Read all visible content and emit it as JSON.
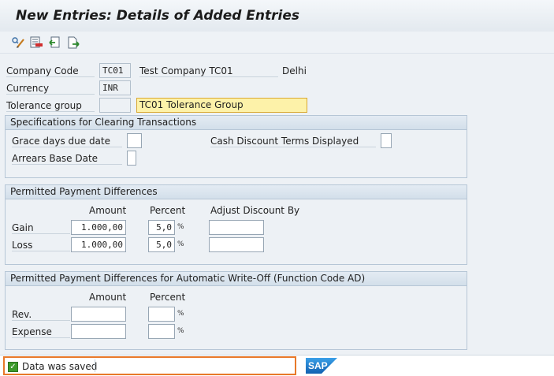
{
  "title": "New Entries: Details of Added Entries",
  "toolbar": {
    "buttons": [
      {
        "icon": "display-change-icon"
      },
      {
        "icon": "delete-row-icon"
      },
      {
        "icon": "undo-change-icon"
      },
      {
        "icon": "new-entry-icon"
      }
    ]
  },
  "header": {
    "company_code_label": "Company Code",
    "company_code_value": "TC01",
    "company_name": "Test Company TC01",
    "city": "Delhi",
    "currency_label": "Currency",
    "currency_value": "INR",
    "tolerance_group_label": "Tolerance group",
    "tolerance_group_value": "",
    "tolerance_group_desc": "TC01 Tolerance Group"
  },
  "clearing": {
    "title": "Specifications for Clearing Transactions",
    "grace_days_label": "Grace days due date",
    "grace_days_value": "",
    "cash_discount_label": "Cash Discount Terms Displayed",
    "cash_discount_value": "",
    "arrears_label": "Arrears Base Date",
    "arrears_value": ""
  },
  "payment_diff": {
    "title": "Permitted Payment Differences",
    "col_amount": "Amount",
    "col_percent": "Percent",
    "col_adjust": "Adjust Discount By",
    "unit": "%",
    "rows": [
      {
        "label": "Gain",
        "amount": "1.000,00",
        "percent": "5,0",
        "adjust": ""
      },
      {
        "label": "Loss",
        "amount": "1.000,00",
        "percent": "5,0",
        "adjust": ""
      }
    ]
  },
  "writeoff": {
    "title": "Permitted Payment Differences for Automatic Write-Off (Function Code AD)",
    "col_amount": "Amount",
    "col_percent": "Percent",
    "unit": "%",
    "rows": [
      {
        "label": "Rev.",
        "amount": "",
        "percent": ""
      },
      {
        "label": "Expense",
        "amount": "",
        "percent": ""
      }
    ]
  },
  "status": {
    "message": "Data was saved",
    "type": "success",
    "color": "#3c9a2b",
    "highlight_color": "#e8792a"
  },
  "brand": {
    "logo_text": "SAP",
    "color": "#1a73c6"
  }
}
